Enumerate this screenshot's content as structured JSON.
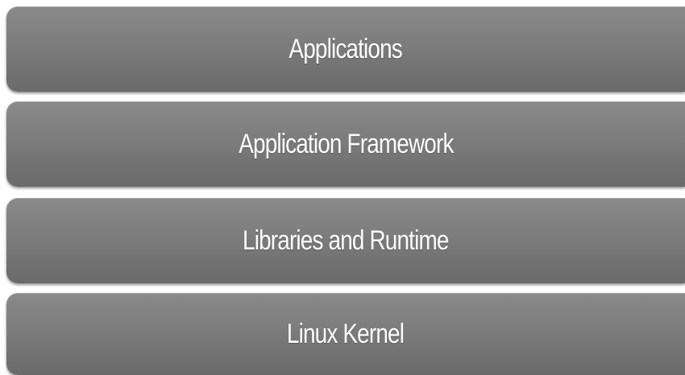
{
  "layers": [
    {
      "label": "Applications"
    },
    {
      "label": "Application Framework"
    },
    {
      "label": "Libraries and Runtime"
    },
    {
      "label": "Linux Kernel"
    }
  ],
  "colors": {
    "layer_fill": "#7e7e7e",
    "label_text": "#ffffff",
    "background": "#ffffff"
  }
}
